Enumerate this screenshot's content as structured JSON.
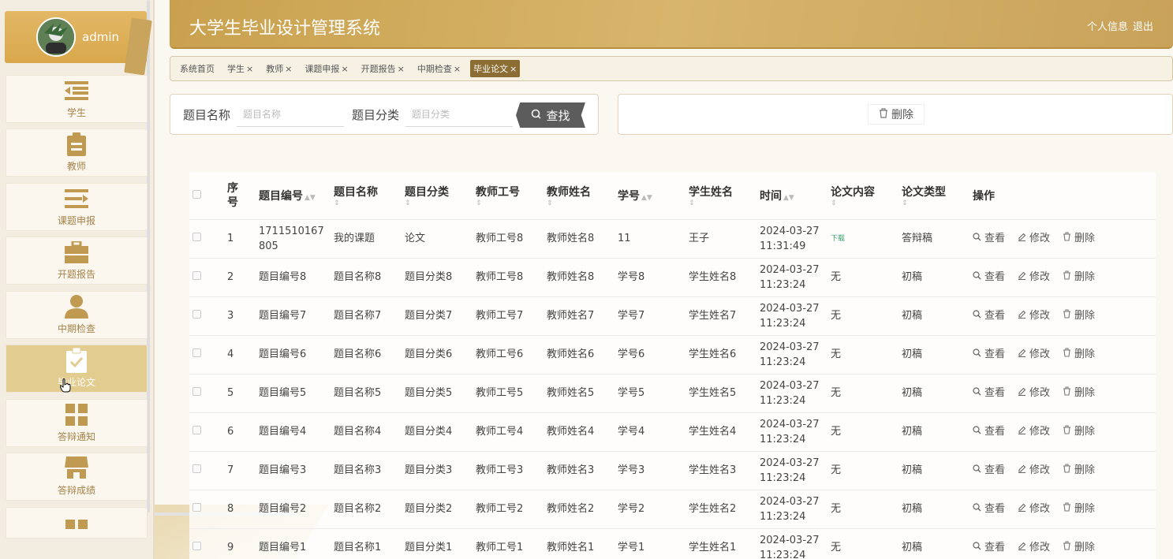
{
  "app_title": "大学生毕业设计管理系统",
  "header": {
    "profile": "个人信息",
    "logout": "退出"
  },
  "user": {
    "name": "admin"
  },
  "sidebar": {
    "items": [
      {
        "label": "学生",
        "icon": "list-icon"
      },
      {
        "label": "教师",
        "icon": "clipboard-icon"
      },
      {
        "label": "课题申报",
        "icon": "list-arrow-icon"
      },
      {
        "label": "开题报告",
        "icon": "briefcase-icon"
      },
      {
        "label": "中期检查",
        "icon": "user-icon"
      },
      {
        "label": "毕业论文",
        "icon": "clipboard-check-icon"
      },
      {
        "label": "答辩通知",
        "icon": "grid-icon"
      },
      {
        "label": "答辩成绩",
        "icon": "store-icon"
      }
    ]
  },
  "tabs": [
    {
      "label": "系统首页",
      "closable": false
    },
    {
      "label": "学生",
      "closable": true
    },
    {
      "label": "教师",
      "closable": true
    },
    {
      "label": "课题申报",
      "closable": true
    },
    {
      "label": "开题报告",
      "closable": true
    },
    {
      "label": "中期检查",
      "closable": true
    },
    {
      "label": "毕业论文",
      "closable": true,
      "active": true
    }
  ],
  "search": {
    "title_label": "题目名称",
    "title_placeholder": "题目名称",
    "category_label": "题目分类",
    "category_placeholder": "题目分类",
    "button": "查找"
  },
  "actions": {
    "delete": "删除"
  },
  "table": {
    "headers": {
      "index": "序号",
      "code": "题目编号",
      "name": "题目名称",
      "category": "题目分类",
      "teacher_id": "教师工号",
      "teacher_name": "教师姓名",
      "student_id": "学号",
      "student_name": "学生姓名",
      "time": "时间",
      "content": "论文内容",
      "type": "论文类型",
      "ops": "操作"
    },
    "op_labels": {
      "view": "查看",
      "edit": "修改",
      "delete": "删除"
    },
    "rows": [
      {
        "index": "1",
        "code": "1711510167805",
        "name": "我的课题",
        "category": "论文",
        "teacher_id": "教师工号8",
        "teacher_name": "教师姓名8",
        "student_id": "11",
        "student_name": "王子",
        "date": "2024-03-27",
        "time": "11:31:49",
        "content": "下载",
        "type": "答辩稿"
      },
      {
        "index": "2",
        "code": "题目编号8",
        "name": "题目名称8",
        "category": "题目分类8",
        "teacher_id": "教师工号8",
        "teacher_name": "教师姓名8",
        "student_id": "学号8",
        "student_name": "学生姓名8",
        "date": "2024-03-27",
        "time": "11:23:24",
        "content": "无",
        "type": "初稿"
      },
      {
        "index": "3",
        "code": "题目编号7",
        "name": "题目名称7",
        "category": "题目分类7",
        "teacher_id": "教师工号7",
        "teacher_name": "教师姓名7",
        "student_id": "学号7",
        "student_name": "学生姓名7",
        "date": "2024-03-27",
        "time": "11:23:24",
        "content": "无",
        "type": "初稿"
      },
      {
        "index": "4",
        "code": "题目编号6",
        "name": "题目名称6",
        "category": "题目分类6",
        "teacher_id": "教师工号6",
        "teacher_name": "教师姓名6",
        "student_id": "学号6",
        "student_name": "学生姓名6",
        "date": "2024-03-27",
        "time": "11:23:24",
        "content": "无",
        "type": "初稿"
      },
      {
        "index": "5",
        "code": "题目编号5",
        "name": "题目名称5",
        "category": "题目分类5",
        "teacher_id": "教师工号5",
        "teacher_name": "教师姓名5",
        "student_id": "学号5",
        "student_name": "学生姓名5",
        "date": "2024-03-27",
        "time": "11:23:24",
        "content": "无",
        "type": "初稿"
      },
      {
        "index": "6",
        "code": "题目编号4",
        "name": "题目名称4",
        "category": "题目分类4",
        "teacher_id": "教师工号4",
        "teacher_name": "教师姓名4",
        "student_id": "学号4",
        "student_name": "学生姓名4",
        "date": "2024-03-27",
        "time": "11:23:24",
        "content": "无",
        "type": "初稿"
      },
      {
        "index": "7",
        "code": "题目编号3",
        "name": "题目名称3",
        "category": "题目分类3",
        "teacher_id": "教师工号3",
        "teacher_name": "教师姓名3",
        "student_id": "学号3",
        "student_name": "学生姓名3",
        "date": "2024-03-27",
        "time": "11:23:24",
        "content": "无",
        "type": "初稿"
      },
      {
        "index": "8",
        "code": "题目编号2",
        "name": "题目名称2",
        "category": "题目分类2",
        "teacher_id": "教师工号2",
        "teacher_name": "教师姓名2",
        "student_id": "学号2",
        "student_name": "学生姓名2",
        "date": "2024-03-27",
        "time": "11:23:24",
        "content": "无",
        "type": "初稿"
      },
      {
        "index": "9",
        "code": "题目编号1",
        "name": "题目名称1",
        "category": "题目分类1",
        "teacher_id": "教师工号1",
        "teacher_name": "教师姓名1",
        "student_id": "学号1",
        "student_name": "学生姓名1",
        "date": "2024-03-27",
        "time": "11:23:24",
        "content": "无",
        "type": "初稿"
      }
    ]
  },
  "colors": {
    "accent": "#d9a84d",
    "header": "#c9a14e",
    "active_tab": "#8c6d33",
    "menu_text": "#a4834a",
    "download_link": "#3aa36a"
  }
}
